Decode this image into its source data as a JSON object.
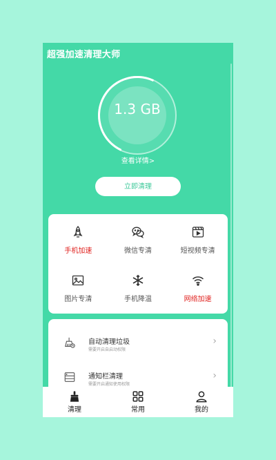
{
  "app": {
    "title": "超强加速清理大师"
  },
  "storage": {
    "size_text": "1.3 GB",
    "details_link": "查看详情>",
    "clean_button": "立即清理"
  },
  "tools": [
    {
      "label": "手机加速",
      "icon": "rocket-icon",
      "highlight": true
    },
    {
      "label": "微信专清",
      "icon": "wechat-icon",
      "highlight": false
    },
    {
      "label": "短视频专清",
      "icon": "video-icon",
      "highlight": false
    },
    {
      "label": "图片专清",
      "icon": "image-icon",
      "highlight": false
    },
    {
      "label": "手机降温",
      "icon": "snowflake-icon",
      "highlight": false
    },
    {
      "label": "网络加速",
      "icon": "wifi-icon",
      "highlight": true
    }
  ],
  "list": [
    {
      "title": "自动清理垃圾",
      "subtitle": "需要开启自启动权限",
      "icon": "broom-icon"
    },
    {
      "title": "通知栏清理",
      "subtitle": "需要开启通知使用权限",
      "icon": "notification-icon"
    }
  ],
  "tabs": [
    {
      "label": "清理",
      "icon": "broom-icon"
    },
    {
      "label": "常用",
      "icon": "grid-icon"
    },
    {
      "label": "我的",
      "icon": "user-icon"
    }
  ],
  "colors": {
    "accent": "#44d9a7",
    "background": "#a6f5dc",
    "highlight": "#e0221f"
  }
}
